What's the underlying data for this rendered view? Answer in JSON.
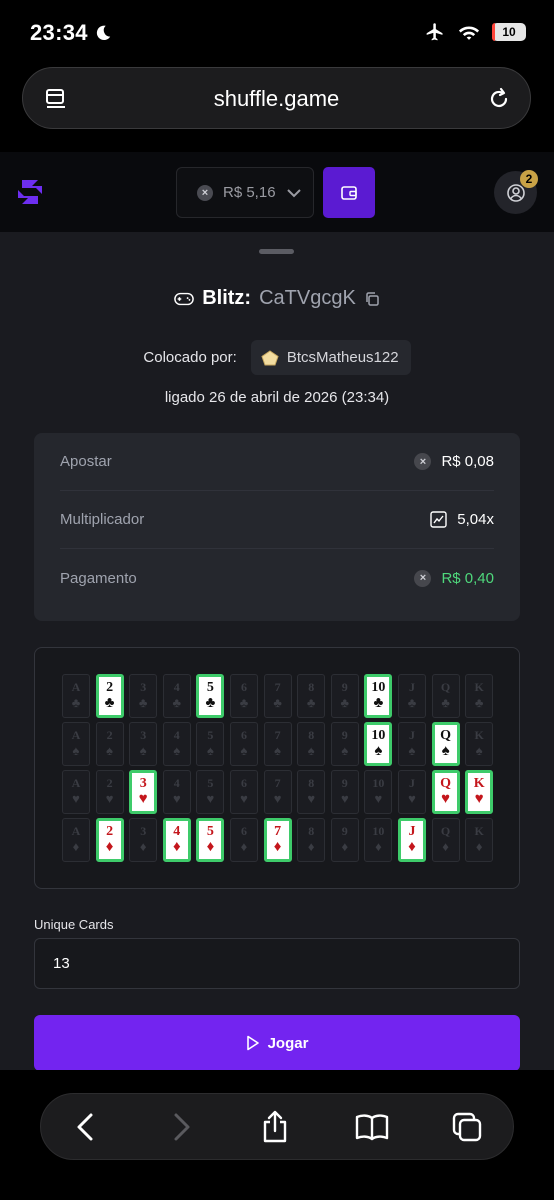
{
  "status_bar": {
    "time": "23:34",
    "battery": "10"
  },
  "browser": {
    "url": "shuffle.game"
  },
  "header": {
    "balance": "R$ 5,16",
    "notification_count": "2"
  },
  "game": {
    "title": "Blitz:",
    "id": "CaTVgcgK",
    "placed_by_label": "Colocado por:",
    "player": "BtcsMatheus122",
    "date": "ligado 26 de abril de 2026 (23:34)"
  },
  "details": [
    {
      "label": "Apostar",
      "value": "R$ 0,08",
      "icon": "coin-icon"
    },
    {
      "label": "Multiplicador",
      "value": "5,04x",
      "icon": "chart-icon"
    },
    {
      "label": "Pagamento",
      "value": "R$ 0,40",
      "icon": "coin-icon"
    }
  ],
  "board": {
    "ranks": [
      "A",
      "2",
      "3",
      "4",
      "5",
      "6",
      "7",
      "8",
      "9",
      "10",
      "J",
      "Q",
      "K"
    ],
    "suits": [
      {
        "name": "clubs",
        "symbol": "♣",
        "color": "black"
      },
      {
        "name": "spades",
        "symbol": "♠",
        "color": "black"
      },
      {
        "name": "hearts",
        "symbol": "♥",
        "color": "red"
      },
      {
        "name": "diamonds",
        "symbol": "♦",
        "color": "red"
      }
    ],
    "selected": {
      "clubs": [
        "2",
        "5",
        "10"
      ],
      "spades": [
        "10",
        "Q"
      ],
      "hearts": [
        "3",
        "Q",
        "K"
      ],
      "diamonds": [
        "2",
        "4",
        "5",
        "7",
        "J"
      ]
    }
  },
  "unique_cards": {
    "label": "Unique Cards",
    "value": "13"
  },
  "play_button": {
    "label": "Jogar"
  }
}
